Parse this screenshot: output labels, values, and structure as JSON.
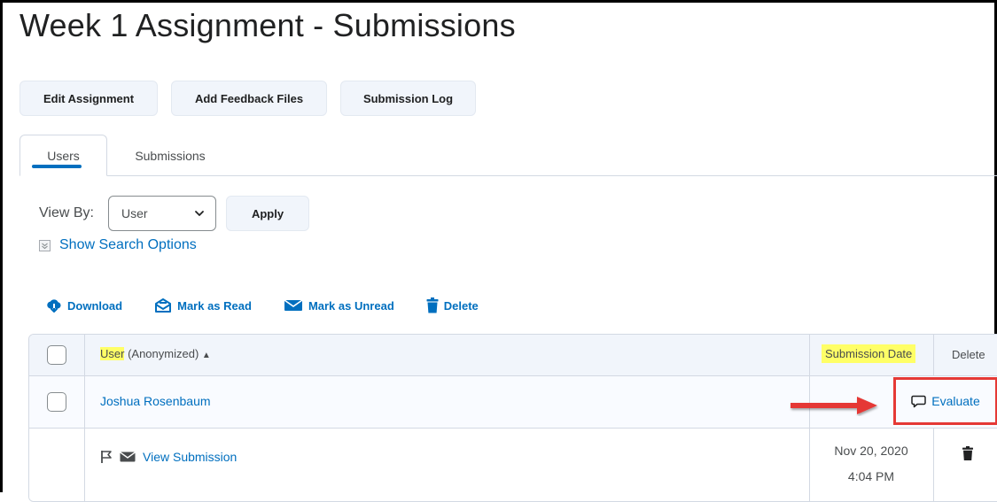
{
  "page": {
    "title": "Week 1 Assignment - Submissions"
  },
  "toolbar": {
    "edit_assignment": "Edit Assignment",
    "add_feedback_files": "Add Feedback Files",
    "submission_log": "Submission Log"
  },
  "tabs": [
    {
      "label": "Users",
      "active": true
    },
    {
      "label": "Submissions",
      "active": false
    }
  ],
  "filter": {
    "view_by_label": "View By:",
    "selected": "User",
    "apply_label": "Apply",
    "search_options_label": "Show Search Options"
  },
  "actions": {
    "download": "Download",
    "mark_read": "Mark as Read",
    "mark_unread": "Mark as Unread",
    "delete": "Delete"
  },
  "table": {
    "headers": {
      "user": "User",
      "user_suffix": "(Anonymized)",
      "sort_indicator": "▲",
      "submission_date": "Submission Date",
      "delete": "Delete"
    },
    "rows": [
      {
        "user": "Joshua Rosenbaum",
        "evaluate_label": "Evaluate",
        "submission": {
          "link_label": "View Submission",
          "date": "Nov 20, 2020",
          "time": "4:04 PM"
        }
      }
    ]
  },
  "colors": {
    "link": "#006fbf",
    "highlight": "#ffff66",
    "annotation_red": "#e53935",
    "button_bg": "#f1f5fb"
  },
  "icons": [
    "download-icon",
    "mark-read-icon",
    "mark-unread-icon",
    "trash-icon",
    "chevron-down-icon",
    "comment-icon",
    "flag-icon",
    "envelope-icon",
    "expand-icon"
  ]
}
